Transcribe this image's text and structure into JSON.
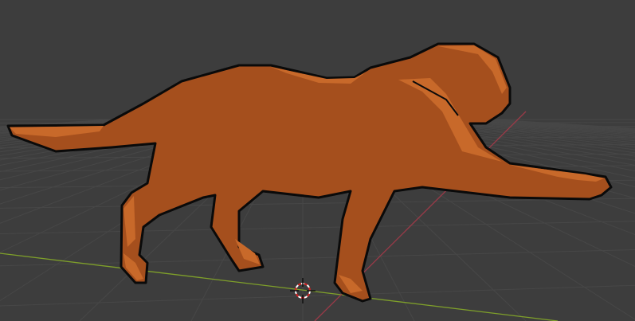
{
  "viewport": {
    "mode": "3d-viewport",
    "object": "low-poly-cat",
    "colors": {
      "background": "#3d3d3d",
      "grid": "#474747",
      "x_axis": "#7fa02a",
      "y_axis": "#9a3a48",
      "body": "#a54f1d",
      "highlight": "#c8692a",
      "outline": "#0a0a0a"
    },
    "icons": [
      "3d-cursor-icon"
    ]
  }
}
